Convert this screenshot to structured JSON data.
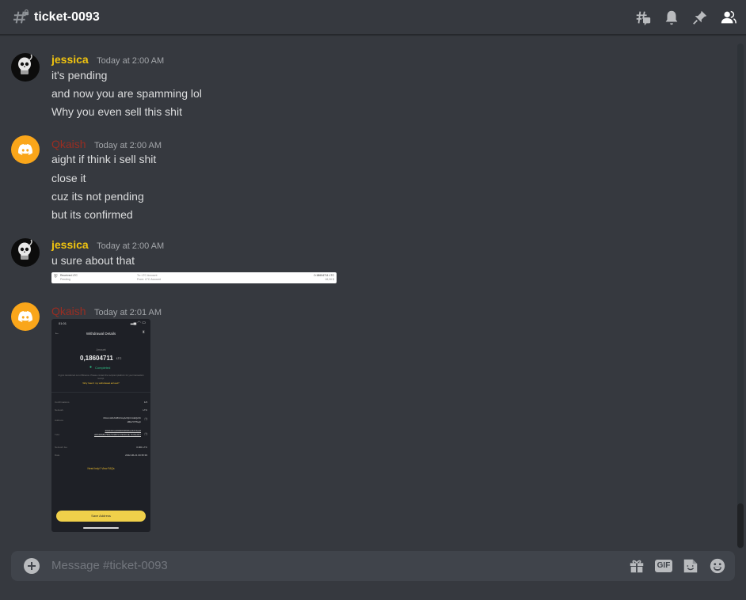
{
  "header": {
    "channel_name": "ticket-0093",
    "icons": [
      "threads-icon",
      "notification-bell-icon",
      "pinned-messages-icon",
      "member-list-icon"
    ]
  },
  "messages": [
    {
      "author": "jessica",
      "timestamp": "Today at 2:00 AM",
      "lines": [
        "it's pending",
        "and now you are spamming lol",
        "Why you even sell this shit"
      ]
    },
    {
      "author": "Qkaish",
      "timestamp": "Today at 2:00 AM",
      "lines": [
        "aight if think i sell shit",
        "close it",
        "cuz its not pending",
        "but its confirmed"
      ]
    },
    {
      "author": "jessica",
      "timestamp": "Today at 2:00 AM",
      "lines": [
        "u sure about that"
      ],
      "attachment": {
        "title": "Received LTC",
        "status": "Pending",
        "to": "To: LTC Account",
        "from": "From: LTC Account",
        "amount": "0.18604711 LTC",
        "fiat": "18,26 $"
      }
    },
    {
      "author": "Qkaish",
      "timestamp": "Today at 2:01 AM",
      "attachment": {
        "time": "01:01",
        "screen_title": "Withdrawal Details",
        "amount_label": "Amount",
        "amount": "0,18604711",
        "unit": "LTC",
        "status": "Completed",
        "note": "Crypto transferred out of Binance. Please contact the recipient platform for your transaction receipt.",
        "link": "Why hasn't my withdrawal arrived?",
        "rows": [
          {
            "label": "Confirmations",
            "value": "1/3"
          },
          {
            "label": "Network",
            "value": "LTC"
          },
          {
            "label": "Address",
            "value": "MAcmHDAN8UFAqArRjCCAEQ2zb 1BkVYPTsqh"
          },
          {
            "label": "TxId",
            "value": "3fb0b0c1e39930b3820ae3cb4ea0 a0f118b8b7561f72387c7c9b1b1E 7b33eb87"
          },
          {
            "label": "Network fee",
            "value": "0.001 LTC"
          },
          {
            "label": "Date",
            "value": "2022-06-21 00:35:39"
          }
        ],
        "help": "Need help? View FAQs",
        "button": "Save Address"
      }
    }
  ],
  "composer": {
    "placeholder": "Message #ticket-0093",
    "gif_label": "GIF",
    "icons": [
      "gift-icon",
      "gif-icon",
      "sticker-icon",
      "emoji-icon"
    ]
  },
  "colors": {
    "background": "#36393f",
    "jessica": "#f1c40f",
    "qkaish": "#992d22",
    "discord_avatar": "#faa61a"
  }
}
